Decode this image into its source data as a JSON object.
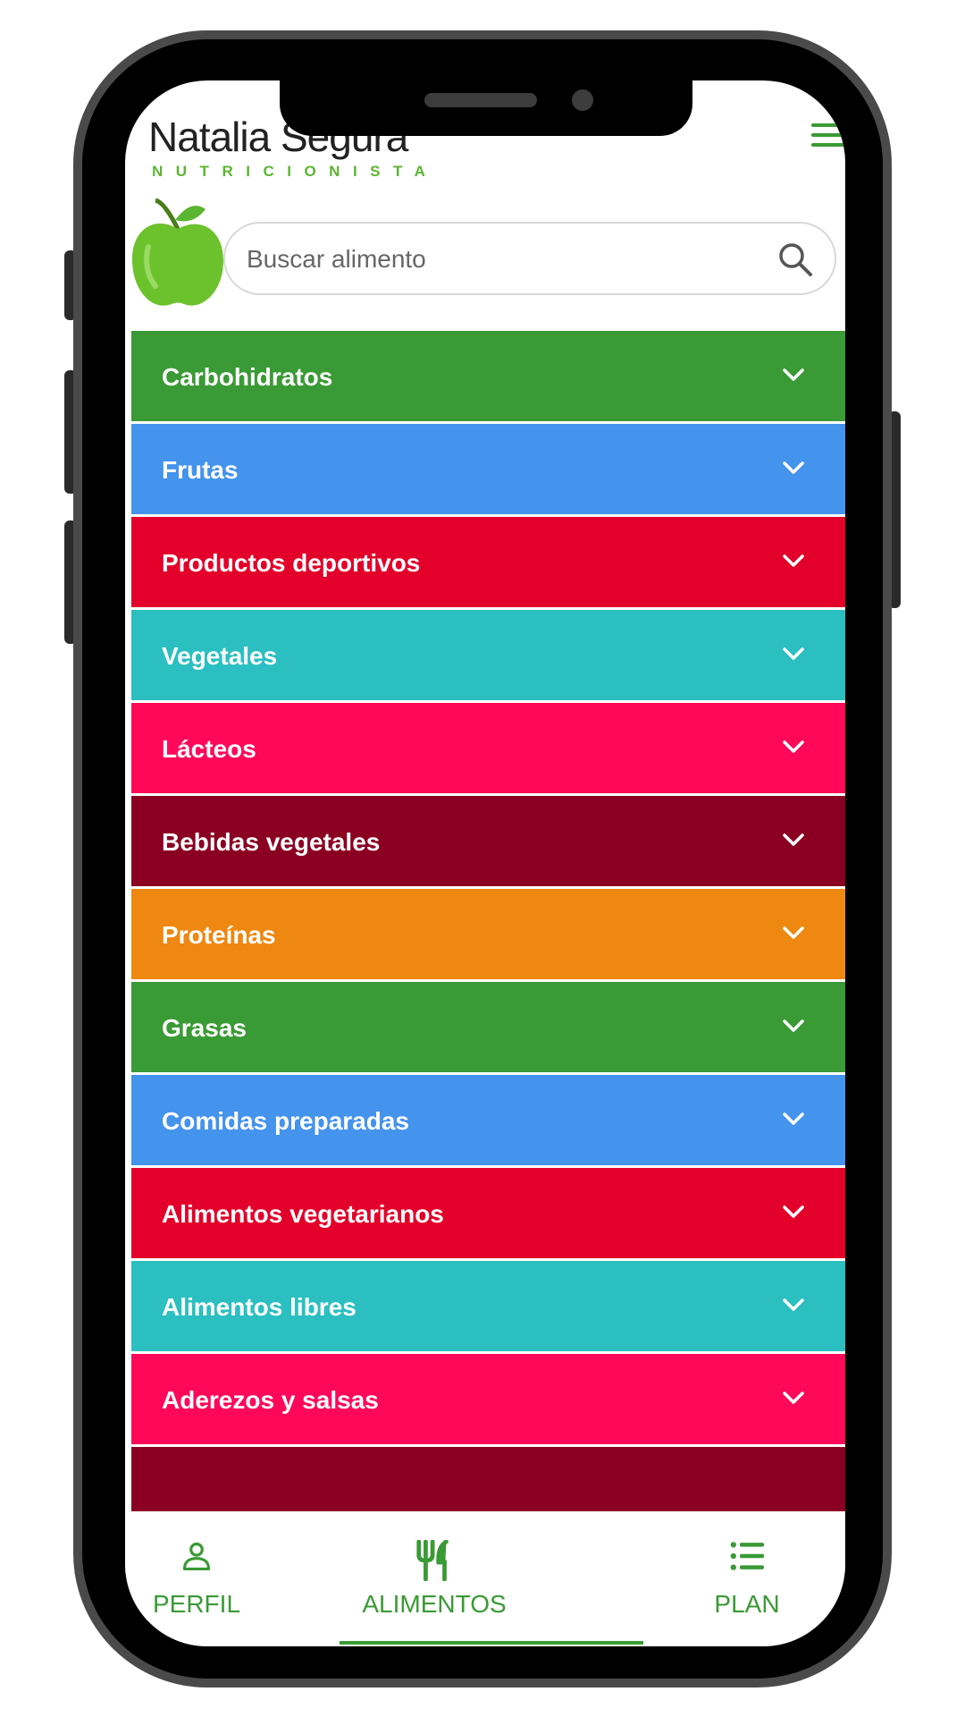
{
  "header": {
    "brand_name": "Natalia Segura",
    "brand_subtitle": "NUTRICIONISTA",
    "menu_icon": "hamburger-menu-icon",
    "logo_icon": "green-apple-icon"
  },
  "search": {
    "placeholder": "Buscar alimento",
    "value": "",
    "icon": "search-icon"
  },
  "categories": [
    {
      "label": "Carbohidratos",
      "color": "#3a9a35"
    },
    {
      "label": "Frutas",
      "color": "#4493ec"
    },
    {
      "label": "Productos deportivos",
      "color": "#e3002a"
    },
    {
      "label": "Vegetales",
      "color": "#2bbfc1"
    },
    {
      "label": "Lácteos",
      "color": "#ff0859"
    },
    {
      "label": "Bebidas vegetales",
      "color": "#8b0022"
    },
    {
      "label": "Proteínas",
      "color": "#ee8811"
    },
    {
      "label": "Grasas",
      "color": "#3a9a35"
    },
    {
      "label": "Comidas preparadas",
      "color": "#4493ec"
    },
    {
      "label": "Alimentos vegetarianos",
      "color": "#e3002a"
    },
    {
      "label": "Alimentos libres",
      "color": "#2bbfc1"
    },
    {
      "label": "Aderezos y salsas",
      "color": "#ff0859"
    },
    {
      "label": "",
      "color": "#8b0022"
    }
  ],
  "bottom_nav": {
    "items": [
      {
        "label": "PERFIL",
        "icon": "person-icon"
      },
      {
        "label": "ALIMENTOS",
        "icon": "fork-knife-icon",
        "active": true
      },
      {
        "label": "PLAN",
        "icon": "list-icon"
      }
    ],
    "accent": "#3a9a35"
  }
}
